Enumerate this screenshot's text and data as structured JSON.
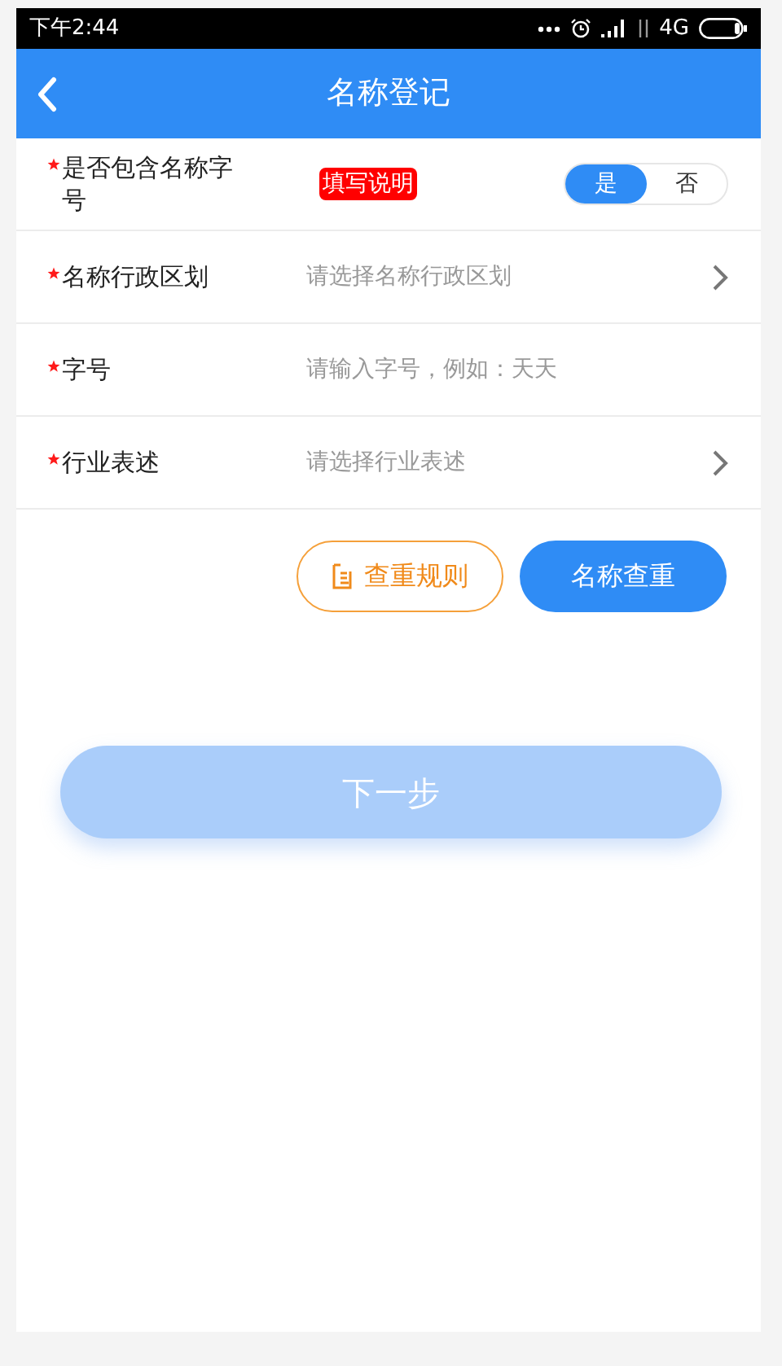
{
  "status_bar": {
    "time": "下午2:44",
    "network": "4G"
  },
  "header": {
    "title": "名称登记"
  },
  "fields": [
    {
      "kind": "toggle",
      "label": "是否包含名称字号",
      "required": true,
      "help_badge": "填写说明",
      "options": [
        {
          "label": "是",
          "selected": true
        },
        {
          "label": "否",
          "selected": false
        }
      ]
    },
    {
      "kind": "select",
      "label": "名称行政区划",
      "required": true,
      "placeholder": "请选择名称行政区划"
    },
    {
      "kind": "input",
      "label": "字号",
      "required": true,
      "placeholder": "请输入字号，例如：天天"
    },
    {
      "kind": "select",
      "label": "行业表述",
      "required": true,
      "placeholder": "请选择行业表述"
    }
  ],
  "actions": [
    {
      "kind": "outline",
      "label": "查重规则"
    },
    {
      "kind": "primary",
      "label": "名称查重"
    }
  ],
  "next_button": {
    "label": "下一步",
    "disabled": true
  }
}
